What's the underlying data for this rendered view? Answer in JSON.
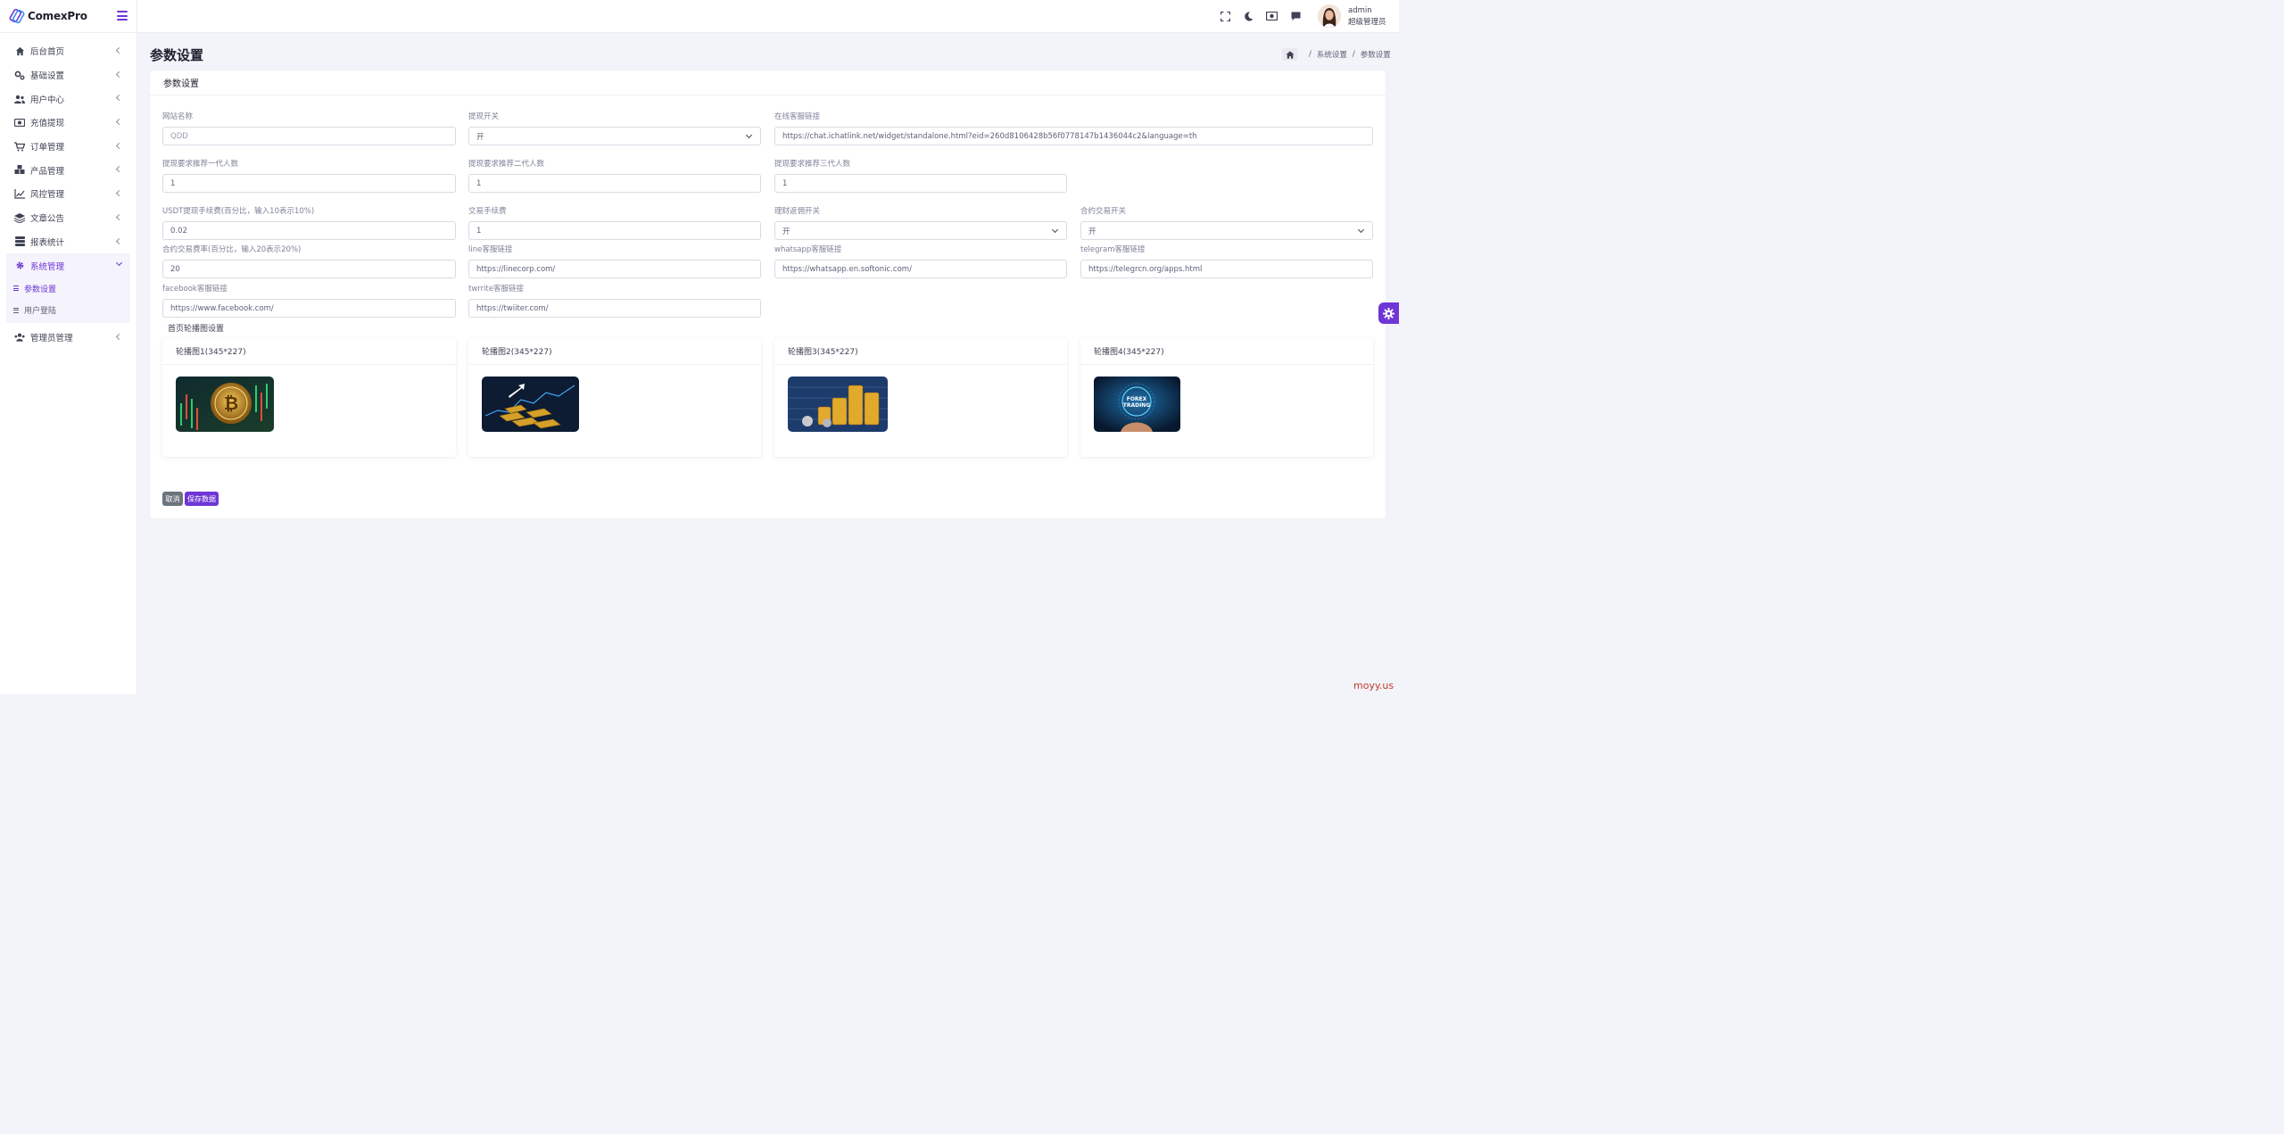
{
  "brand": {
    "name": "ComexPro"
  },
  "sidebar": {
    "items": [
      {
        "label": "后台首页",
        "icon": "home-icon"
      },
      {
        "label": "基础设置",
        "icon": "cogs-icon"
      },
      {
        "label": "用户中心",
        "icon": "users-icon"
      },
      {
        "label": "充值提现",
        "icon": "money-icon"
      },
      {
        "label": "订单管理",
        "icon": "cart-icon"
      },
      {
        "label": "产品管理",
        "icon": "boxes-icon"
      },
      {
        "label": "风控管理",
        "icon": "line-chart-icon"
      },
      {
        "label": "文章公告",
        "icon": "layers-icon"
      },
      {
        "label": "报表统计",
        "icon": "stack-icon"
      },
      {
        "label": "系统管理",
        "icon": "gear-icon",
        "open": true,
        "children": [
          {
            "label": "参数设置",
            "active": true
          },
          {
            "label": "用户登陆"
          }
        ]
      },
      {
        "label": "管理员管理",
        "icon": "admin-group-icon"
      }
    ]
  },
  "topbar": {
    "icons": [
      "fullscreen-icon",
      "moon-icon",
      "cash-icon",
      "chat-icon"
    ],
    "user": {
      "name": "admin",
      "role": "超级管理员"
    }
  },
  "page": {
    "title": "参数设置",
    "breadcrumb": [
      "系统设置",
      "参数设置"
    ]
  },
  "form": {
    "card_title": "参数设置",
    "site_name": {
      "label": "网站名称",
      "placeholder": "QDD"
    },
    "withdraw_switch": {
      "label": "提现开关",
      "value": "开"
    },
    "online_service": {
      "label": "在线客服链接",
      "value": "https://chat.ichatlink.net/widget/standalone.html?eid=260d8106428b56f0778147b1436044c2&language=th"
    },
    "ref_level1": {
      "label": "提现要求推荐一代人数",
      "value": "1"
    },
    "ref_level2": {
      "label": "提现要求推荐二代人数",
      "value": "1"
    },
    "ref_level3": {
      "label": "提现要求推荐三代人数",
      "value": "1"
    },
    "usdt_fee": {
      "label": "USDT提现手续费(百分比，输入10表示10%)",
      "value": "0.02"
    },
    "trade_fee": {
      "label": "交易手续费",
      "value": "1"
    },
    "finance_rebate": {
      "label": "理财返佣开关",
      "value": "开"
    },
    "contract_switch": {
      "label": "合约交易开关",
      "value": "开"
    },
    "contract_rate": {
      "label": "合约交易费率(百分比，输入20表示20%)",
      "value": "20"
    },
    "line_link": {
      "label": "line客服链接",
      "value": "https://linecorp.com/"
    },
    "whatsapp_link": {
      "label": "whatsapp客服链接",
      "value": "https://whatsapp.en.softonic.com/"
    },
    "telegram_link": {
      "label": "telegram客服链接",
      "value": "https://telegrcn.org/apps.html"
    },
    "facebook_link": {
      "label": "facebook客服链接",
      "value": "https://www.facebook.com/"
    },
    "twitter_link": {
      "label": "twrrite客服链接",
      "value": "https://twiiter.com/"
    },
    "carousel_title": "首页轮播图设置",
    "slides": [
      {
        "title": "轮播图1(345*227)",
        "image": "bitcoin-chart-image"
      },
      {
        "title": "轮播图2(345*227)",
        "image": "gold-bars-chart-image"
      },
      {
        "title": "轮播图3(345*227)",
        "image": "coins-stack-image"
      },
      {
        "title": "轮播图4(345*227)",
        "image": "forex-trading-image"
      }
    ],
    "cancel_label": "取消",
    "save_label": "保存数据"
  },
  "slide_texts": {
    "forex": "FOREX",
    "trading": "TRADING"
  },
  "watermark": "moyy.us",
  "colors": {
    "accent": "#6f36d6",
    "cancel": "#6c757d",
    "watermark": "#c0392b"
  }
}
